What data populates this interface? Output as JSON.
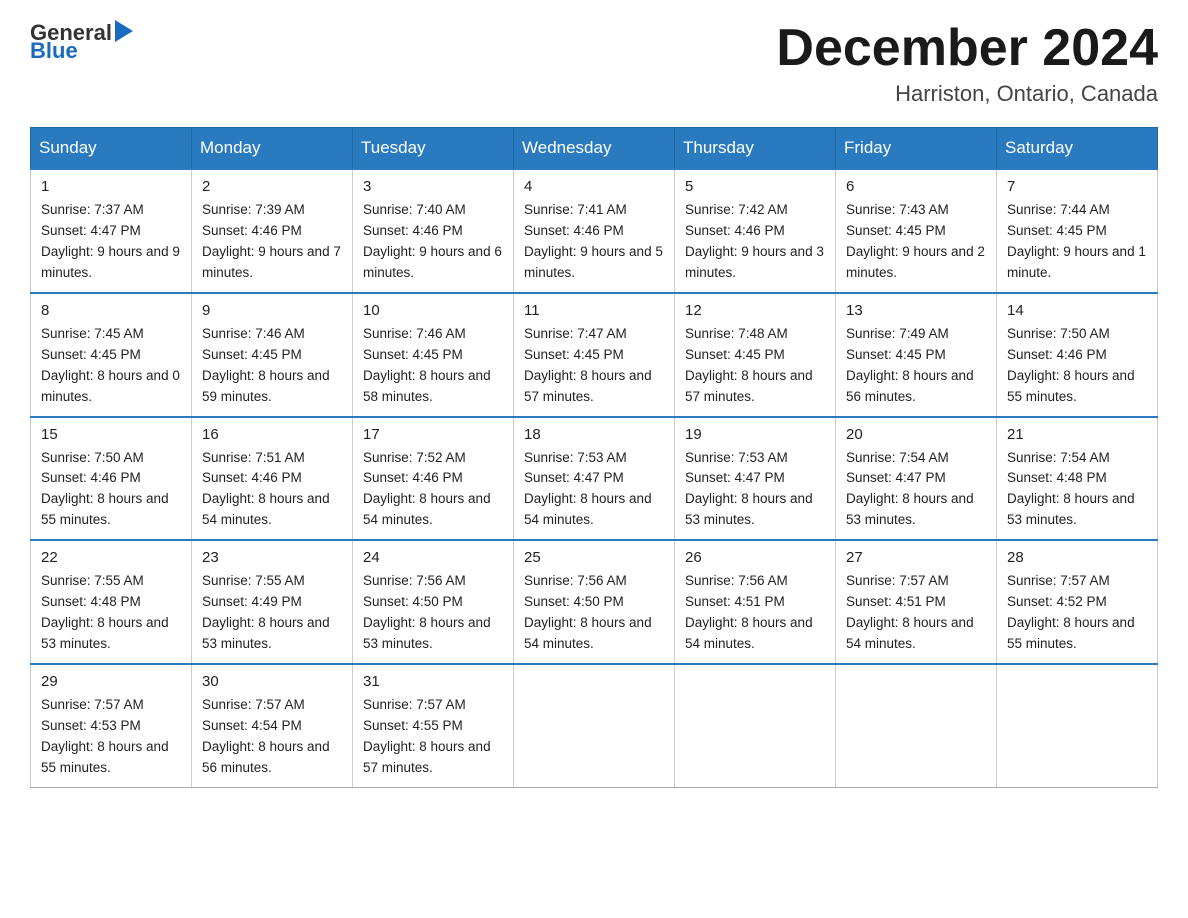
{
  "logo": {
    "general": "General",
    "arrow": "▶",
    "blue": "Blue"
  },
  "title": "December 2024",
  "location": "Harriston, Ontario, Canada",
  "weekdays": [
    "Sunday",
    "Monday",
    "Tuesday",
    "Wednesday",
    "Thursday",
    "Friday",
    "Saturday"
  ],
  "weeks": [
    [
      {
        "day": "1",
        "sunrise": "7:37 AM",
        "sunset": "4:47 PM",
        "daylight": "9 hours and 9 minutes."
      },
      {
        "day": "2",
        "sunrise": "7:39 AM",
        "sunset": "4:46 PM",
        "daylight": "9 hours and 7 minutes."
      },
      {
        "day": "3",
        "sunrise": "7:40 AM",
        "sunset": "4:46 PM",
        "daylight": "9 hours and 6 minutes."
      },
      {
        "day": "4",
        "sunrise": "7:41 AM",
        "sunset": "4:46 PM",
        "daylight": "9 hours and 5 minutes."
      },
      {
        "day": "5",
        "sunrise": "7:42 AM",
        "sunset": "4:46 PM",
        "daylight": "9 hours and 3 minutes."
      },
      {
        "day": "6",
        "sunrise": "7:43 AM",
        "sunset": "4:45 PM",
        "daylight": "9 hours and 2 minutes."
      },
      {
        "day": "7",
        "sunrise": "7:44 AM",
        "sunset": "4:45 PM",
        "daylight": "9 hours and 1 minute."
      }
    ],
    [
      {
        "day": "8",
        "sunrise": "7:45 AM",
        "sunset": "4:45 PM",
        "daylight": "8 hours and 0 minutes."
      },
      {
        "day": "9",
        "sunrise": "7:46 AM",
        "sunset": "4:45 PM",
        "daylight": "8 hours and 59 minutes."
      },
      {
        "day": "10",
        "sunrise": "7:46 AM",
        "sunset": "4:45 PM",
        "daylight": "8 hours and 58 minutes."
      },
      {
        "day": "11",
        "sunrise": "7:47 AM",
        "sunset": "4:45 PM",
        "daylight": "8 hours and 57 minutes."
      },
      {
        "day": "12",
        "sunrise": "7:48 AM",
        "sunset": "4:45 PM",
        "daylight": "8 hours and 57 minutes."
      },
      {
        "day": "13",
        "sunrise": "7:49 AM",
        "sunset": "4:45 PM",
        "daylight": "8 hours and 56 minutes."
      },
      {
        "day": "14",
        "sunrise": "7:50 AM",
        "sunset": "4:46 PM",
        "daylight": "8 hours and 55 minutes."
      }
    ],
    [
      {
        "day": "15",
        "sunrise": "7:50 AM",
        "sunset": "4:46 PM",
        "daylight": "8 hours and 55 minutes."
      },
      {
        "day": "16",
        "sunrise": "7:51 AM",
        "sunset": "4:46 PM",
        "daylight": "8 hours and 54 minutes."
      },
      {
        "day": "17",
        "sunrise": "7:52 AM",
        "sunset": "4:46 PM",
        "daylight": "8 hours and 54 minutes."
      },
      {
        "day": "18",
        "sunrise": "7:53 AM",
        "sunset": "4:47 PM",
        "daylight": "8 hours and 54 minutes."
      },
      {
        "day": "19",
        "sunrise": "7:53 AM",
        "sunset": "4:47 PM",
        "daylight": "8 hours and 53 minutes."
      },
      {
        "day": "20",
        "sunrise": "7:54 AM",
        "sunset": "4:47 PM",
        "daylight": "8 hours and 53 minutes."
      },
      {
        "day": "21",
        "sunrise": "7:54 AM",
        "sunset": "4:48 PM",
        "daylight": "8 hours and 53 minutes."
      }
    ],
    [
      {
        "day": "22",
        "sunrise": "7:55 AM",
        "sunset": "4:48 PM",
        "daylight": "8 hours and 53 minutes."
      },
      {
        "day": "23",
        "sunrise": "7:55 AM",
        "sunset": "4:49 PM",
        "daylight": "8 hours and 53 minutes."
      },
      {
        "day": "24",
        "sunrise": "7:56 AM",
        "sunset": "4:50 PM",
        "daylight": "8 hours and 53 minutes."
      },
      {
        "day": "25",
        "sunrise": "7:56 AM",
        "sunset": "4:50 PM",
        "daylight": "8 hours and 54 minutes."
      },
      {
        "day": "26",
        "sunrise": "7:56 AM",
        "sunset": "4:51 PM",
        "daylight": "8 hours and 54 minutes."
      },
      {
        "day": "27",
        "sunrise": "7:57 AM",
        "sunset": "4:51 PM",
        "daylight": "8 hours and 54 minutes."
      },
      {
        "day": "28",
        "sunrise": "7:57 AM",
        "sunset": "4:52 PM",
        "daylight": "8 hours and 55 minutes."
      }
    ],
    [
      {
        "day": "29",
        "sunrise": "7:57 AM",
        "sunset": "4:53 PM",
        "daylight": "8 hours and 55 minutes."
      },
      {
        "day": "30",
        "sunrise": "7:57 AM",
        "sunset": "4:54 PM",
        "daylight": "8 hours and 56 minutes."
      },
      {
        "day": "31",
        "sunrise": "7:57 AM",
        "sunset": "4:55 PM",
        "daylight": "8 hours and 57 minutes."
      },
      null,
      null,
      null,
      null
    ]
  ],
  "labels": {
    "sunrise": "Sunrise: ",
    "sunset": "Sunset: ",
    "daylight": "Daylight: "
  }
}
